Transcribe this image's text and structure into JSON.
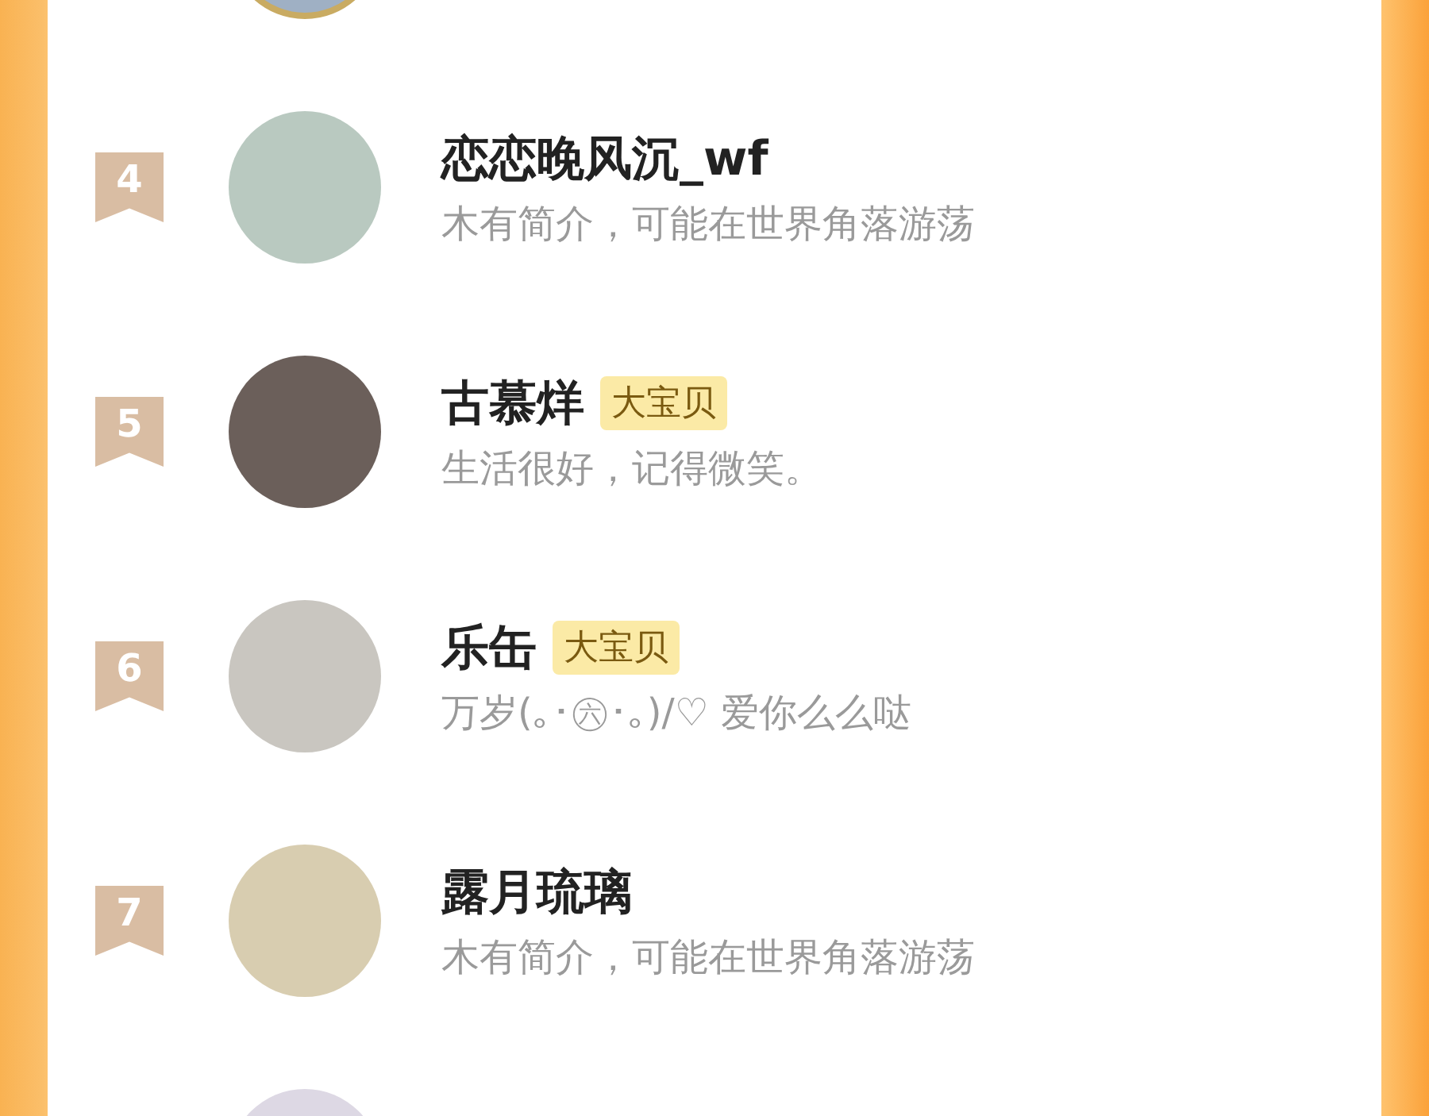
{
  "rows": [
    {
      "avatar_ring": true
    },
    {
      "rank": "4",
      "name": "恋恋晚风沉_wf",
      "bio": "木有简介，可能在世界角落游荡",
      "avatar_ring": false
    },
    {
      "rank": "5",
      "name": "古慕烊",
      "tag": "大宝贝",
      "bio": "生活很好，记得微笑。",
      "avatar_ring": false
    },
    {
      "rank": "6",
      "name": "乐缶",
      "tag": "大宝贝",
      "bio": "万岁(｡･㊅･｡)/♡ 爱你么么哒",
      "avatar_ring": false
    },
    {
      "rank": "7",
      "name": "露月琉璃",
      "bio": "木有简介，可能在世界角落游荡",
      "avatar_ring": false
    },
    {
      "avatar_ring": false
    }
  ]
}
